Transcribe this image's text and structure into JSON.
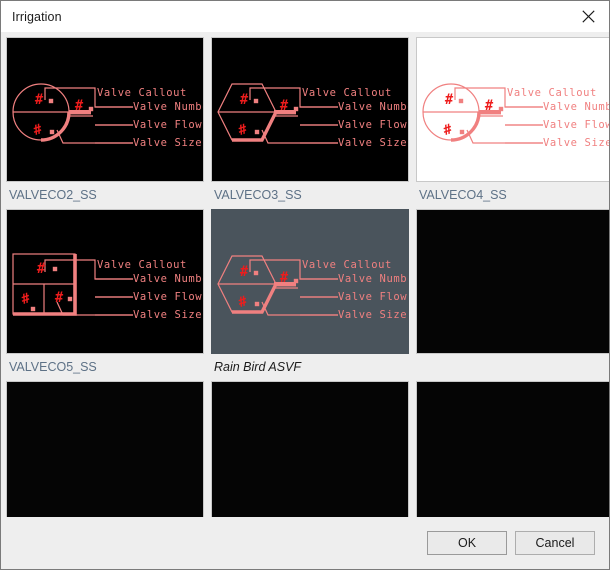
{
  "window": {
    "title": "Irrigation",
    "close_icon": "close-icon"
  },
  "palette": {
    "callout_stroke": "#f08080",
    "symbol_fill": "#ee1c1c",
    "thumb_dark_bg": "#000000",
    "thumb_light_bg": "#ffffff",
    "thumb_selected_bg": "#4a545c",
    "label_color": "#5d7186",
    "label_selected_color": "#1c1c1c",
    "dialog_bg": "#eeeeee",
    "titlebar_bg": "#ffffff"
  },
  "callout": {
    "title": "Valve Callout",
    "lines": [
      "Valve Number",
      "Valve Flow",
      "Valve Size"
    ],
    "symbol_text": "#"
  },
  "grid": {
    "columns": 3,
    "items": [
      {
        "label": "VALVECO2_SS",
        "shape": "circle",
        "state": "dark",
        "has_drawing": true
      },
      {
        "label": "VALVECO3_SS",
        "shape": "hexagon",
        "state": "dark",
        "has_drawing": true
      },
      {
        "label": "VALVECO4_SS",
        "shape": "circle",
        "state": "light",
        "has_drawing": true
      },
      {
        "label": "VALVECO5_SS",
        "shape": "box",
        "state": "dark",
        "has_drawing": true
      },
      {
        "label": "Rain Bird ASVF",
        "shape": "hexagon",
        "state": "selected",
        "has_drawing": true
      },
      {
        "label": "",
        "shape": "none",
        "state": "empty",
        "has_drawing": false
      },
      {
        "label": "",
        "shape": "none",
        "state": "empty",
        "has_drawing": false
      },
      {
        "label": "",
        "shape": "none",
        "state": "empty",
        "has_drawing": false
      },
      {
        "label": "",
        "shape": "none",
        "state": "empty",
        "has_drawing": false
      }
    ]
  },
  "footer": {
    "ok_label": "OK",
    "cancel_label": "Cancel"
  }
}
